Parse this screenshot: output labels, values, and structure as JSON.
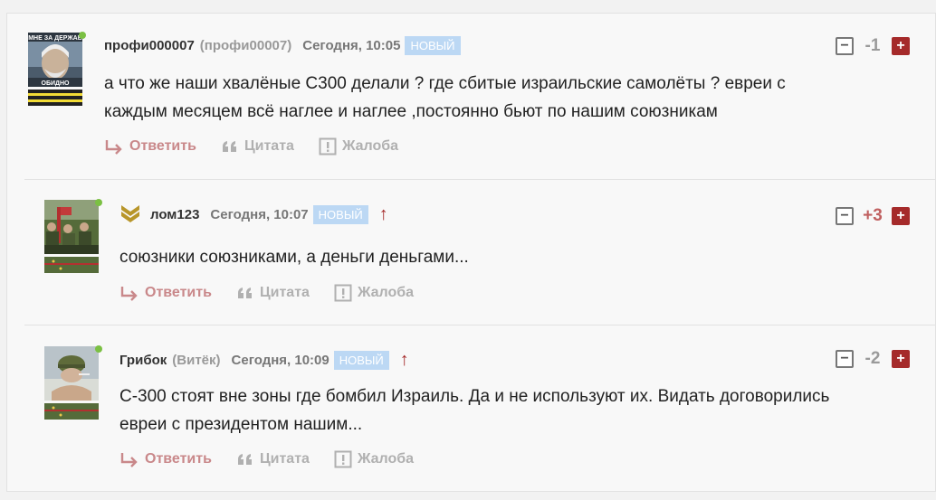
{
  "comments": [
    {
      "author": "профи000007",
      "alias": "(профи00007)",
      "date": "Сегодня, 10:05",
      "badge": "НОВЫЙ",
      "text_line1": "а что же наши хвалёные С300 делали ? где сбитые израильские самолёты ? евреи с",
      "text_line2": "каждым месяцем всё наглее и наглее ,постоянно бьют по нашим союзникам",
      "score": "-1",
      "avatar_caption_top": "МНЕ ЗА ДЕРЖАВ",
      "avatar_caption_bottom": "ОБИДНО"
    },
    {
      "author": "лом123",
      "date": "Сегодня, 10:07",
      "badge": "НОВЫЙ",
      "arrow": "↑",
      "text_line1": "союзники союзниками, а деньги деньгами...",
      "score": "+3"
    },
    {
      "author": "Грибок",
      "alias": "(Витёк)",
      "date": "Сегодня, 10:09",
      "badge": "НОВЫЙ",
      "arrow": "↑",
      "text_line1": "С-300 стоят вне зоны где бомбил Израиль. Да и не используют их. Видать договорились",
      "text_line2": "евреи с президентом нашим...",
      "score": "-2"
    }
  ],
  "actions": {
    "reply": "Ответить",
    "quote": "Цитата",
    "complaint": "Жалоба"
  },
  "vote": {
    "minus": "−",
    "plus": "+"
  },
  "colors": {
    "accent": "#a52a2a",
    "reply": "#c9888a",
    "badge": "#bcd8f4",
    "online": "#7bc043"
  }
}
